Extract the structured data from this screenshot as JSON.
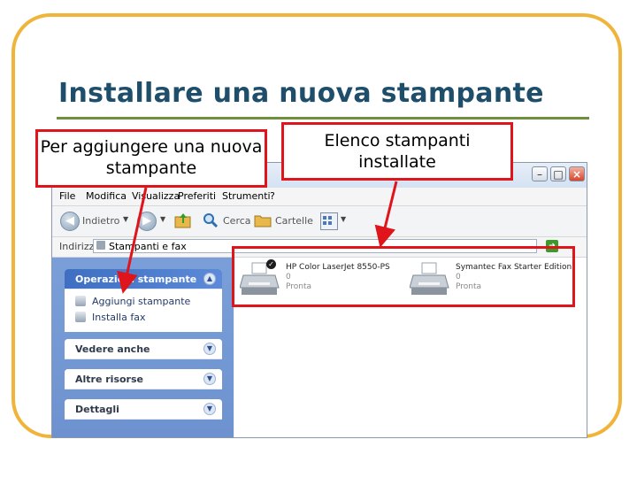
{
  "slide": {
    "title": "Installare una nuova stampante",
    "callout_left": "Per aggiungere una nuova stampante",
    "callout_right": "Elenco stampanti installate"
  },
  "window": {
    "menu": [
      "File",
      "Modifica",
      "Visualizza",
      "Preferiti",
      "Strumenti",
      "?"
    ],
    "toolbar": {
      "back_label": "Indietro",
      "search_label": "Cerca",
      "folders_label": "Cartelle"
    },
    "address": {
      "label": "Indirizzo",
      "value": "Stampanti e fax"
    },
    "sidebar": {
      "tasks_title": "Operazioni stampante",
      "tasks": [
        "Aggiungi stampante",
        "Installa fax"
      ],
      "see_also_title": "Vedere anche",
      "other_places_title": "Altre risorse",
      "details_title": "Dettagli"
    },
    "printers": [
      {
        "name": "HP Color LaserJet 8550-PS",
        "count": "0",
        "status": "Pronta",
        "default": true
      },
      {
        "name": "Symantec Fax Starter Edition",
        "count": "0",
        "status": "Pronta",
        "default": false
      }
    ]
  },
  "colors": {
    "frame": "#f0b43a",
    "title": "#1f4e6b",
    "rule": "#6f8f3a",
    "annotation": "#e0151b",
    "sidebar": "#7a9fd8"
  },
  "icons": [
    "back-icon",
    "forward-icon",
    "up-folder-icon",
    "search-icon",
    "folders-icon",
    "views-icon",
    "printer-icon",
    "fax-icon",
    "default-check-icon",
    "go-icon",
    "chevron-up-icon",
    "chevron-down-icon",
    "minimize-icon",
    "maximize-icon",
    "close-icon"
  ]
}
